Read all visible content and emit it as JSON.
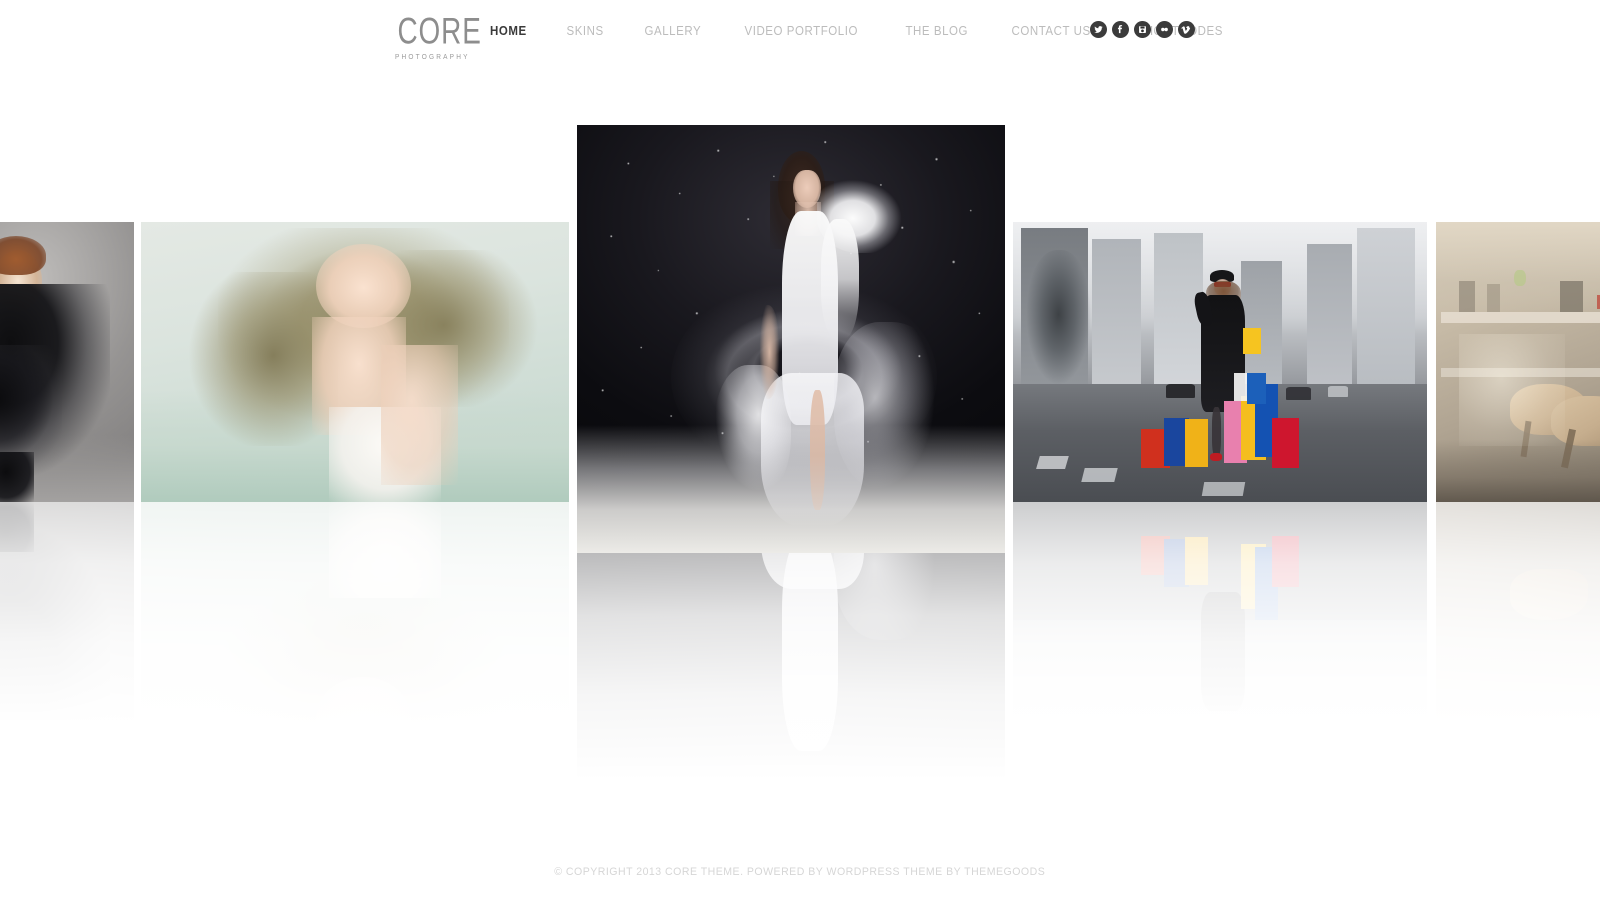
{
  "site": {
    "logo_main": "CORE",
    "logo_sub": "PHOTOGRAPHY"
  },
  "nav": {
    "items": [
      {
        "label": "HOME",
        "active": true
      },
      {
        "label": "SKINS",
        "active": false
      },
      {
        "label": "GALLERY",
        "active": false
      },
      {
        "label": "VIDEO PORTFOLIO",
        "active": false
      },
      {
        "label": "THE BLOG",
        "active": false
      },
      {
        "label": "CONTACT US",
        "active": false
      },
      {
        "label": "SHORTCODES",
        "active": false
      }
    ]
  },
  "social": {
    "items": [
      {
        "name": "twitter-icon",
        "label": "Twitter"
      },
      {
        "name": "facebook-icon",
        "label": "Facebook"
      },
      {
        "name": "instagram-icon",
        "label": "Instagram"
      },
      {
        "name": "flickr-icon",
        "label": "Flickr"
      },
      {
        "name": "vimeo-icon",
        "label": "Vimeo"
      }
    ]
  },
  "gallery": {
    "slides": [
      {
        "alt": "Model in black splash dress against concrete wall"
      },
      {
        "alt": "Blonde woman lying down with flowing hair"
      },
      {
        "alt": "Model in white gown with falling snow"
      },
      {
        "alt": "Woman with colorful shopping bags on city street"
      },
      {
        "alt": "High heel shoes on display shelf"
      }
    ],
    "active_index": 2
  },
  "footer": {
    "copyright_prefix": "© COPYRIGHT 2013 CORE THEME. POWERED BY ",
    "wordpress_link": "WORDPRESS",
    "middle": " THEME BY ",
    "themegoods_link": "THEMEGOODS"
  },
  "colors": {
    "accent": "#3a3a3a",
    "nav_inactive": "#bcbcbc",
    "logo": "#8d8d8d",
    "social_bg": "#3b3b3b",
    "footer_text": "#d6d6d6",
    "page_bg": "#ffffff"
  }
}
